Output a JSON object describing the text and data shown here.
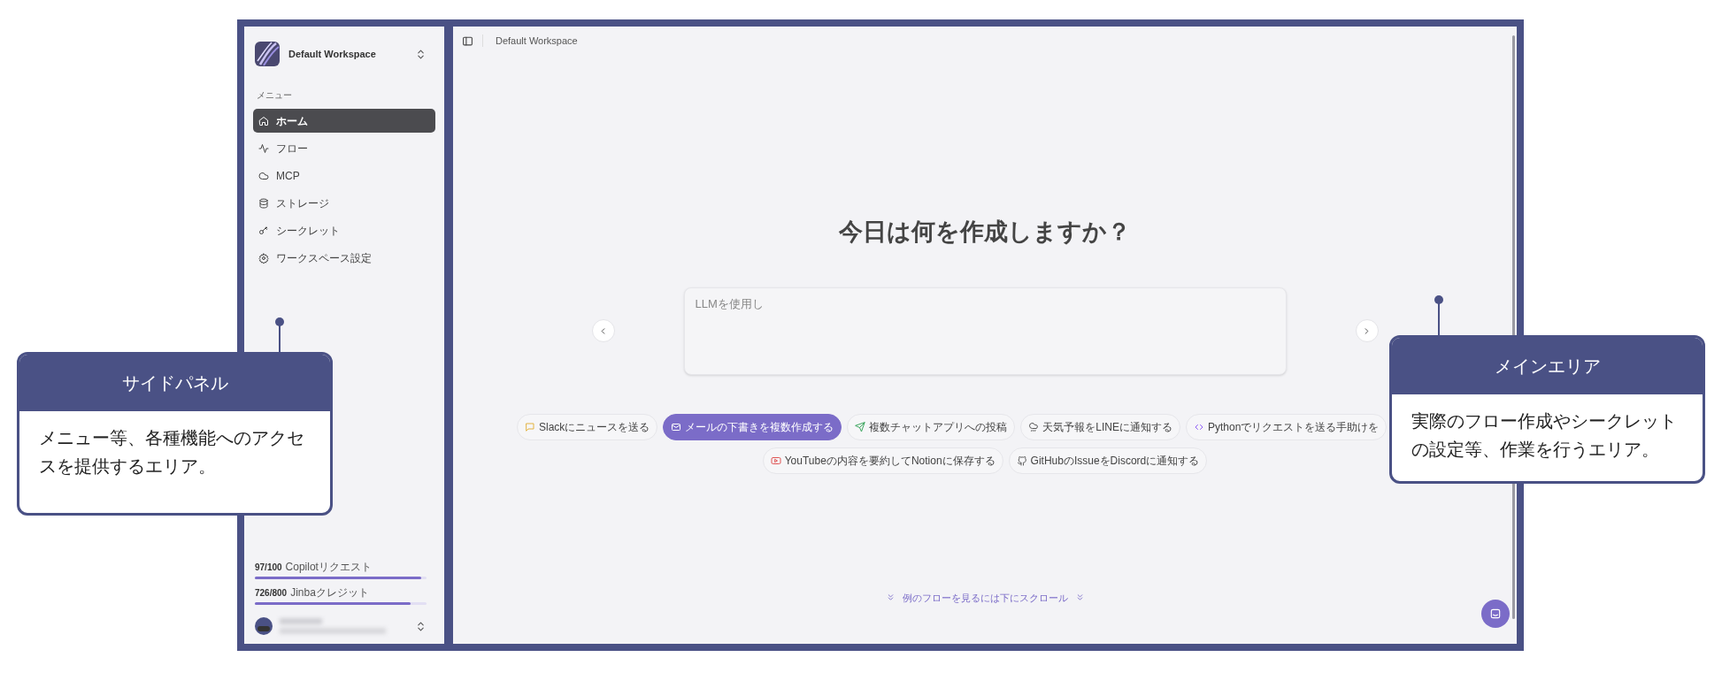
{
  "sidebar": {
    "workspace": "Default Workspace",
    "menu_label": "メニュー",
    "items": [
      {
        "label": "ホーム",
        "selected": true
      },
      {
        "label": "フロー",
        "selected": false
      },
      {
        "label": "MCP",
        "selected": false
      },
      {
        "label": "ストレージ",
        "selected": false
      },
      {
        "label": "シークレット",
        "selected": false
      },
      {
        "label": "ワークスペース設定",
        "selected": false
      }
    ],
    "usage": [
      {
        "count": "97/100",
        "label": "Copilotリクエスト",
        "level": 0.97
      },
      {
        "count": "726/800",
        "label": "Jinbaクレジット",
        "level": 0.9075
      }
    ]
  },
  "main": {
    "breadcrumb": "Default Workspace",
    "heading": "今日は何を作成しますか？",
    "input": {
      "placeholder": "LLMを使用し"
    },
    "suggestion_rows": [
      {
        "chips": [
          {
            "label": "Slackにニュースを送る",
            "selected": false
          },
          {
            "label": "メールの下書きを複数作成する",
            "selected": true
          },
          {
            "label": "複数チャットアプリへの投稿",
            "selected": false
          },
          {
            "label": "天気予報をLINEに通知する",
            "selected": false
          },
          {
            "label": "Pythonでリクエストを送る手助けを",
            "selected": false
          }
        ]
      },
      {
        "chips": [
          {
            "label": "YouTubeの内容を要約してNotionに保存する",
            "selected": false
          },
          {
            "label": "GitHubのIssueをDiscordに通知する",
            "selected": false
          }
        ]
      }
    ],
    "scroll_hint": "例のフローを見るには下にスクロール"
  },
  "callouts": [
    {
      "title": "サイドパネル",
      "body": "メニュー等、各種機能へのアクセスを提供するエリア。"
    },
    {
      "title": "メインエリア",
      "body": "実際のフロー作成やシークレットの設定等、作業を行うエリア。"
    }
  ]
}
